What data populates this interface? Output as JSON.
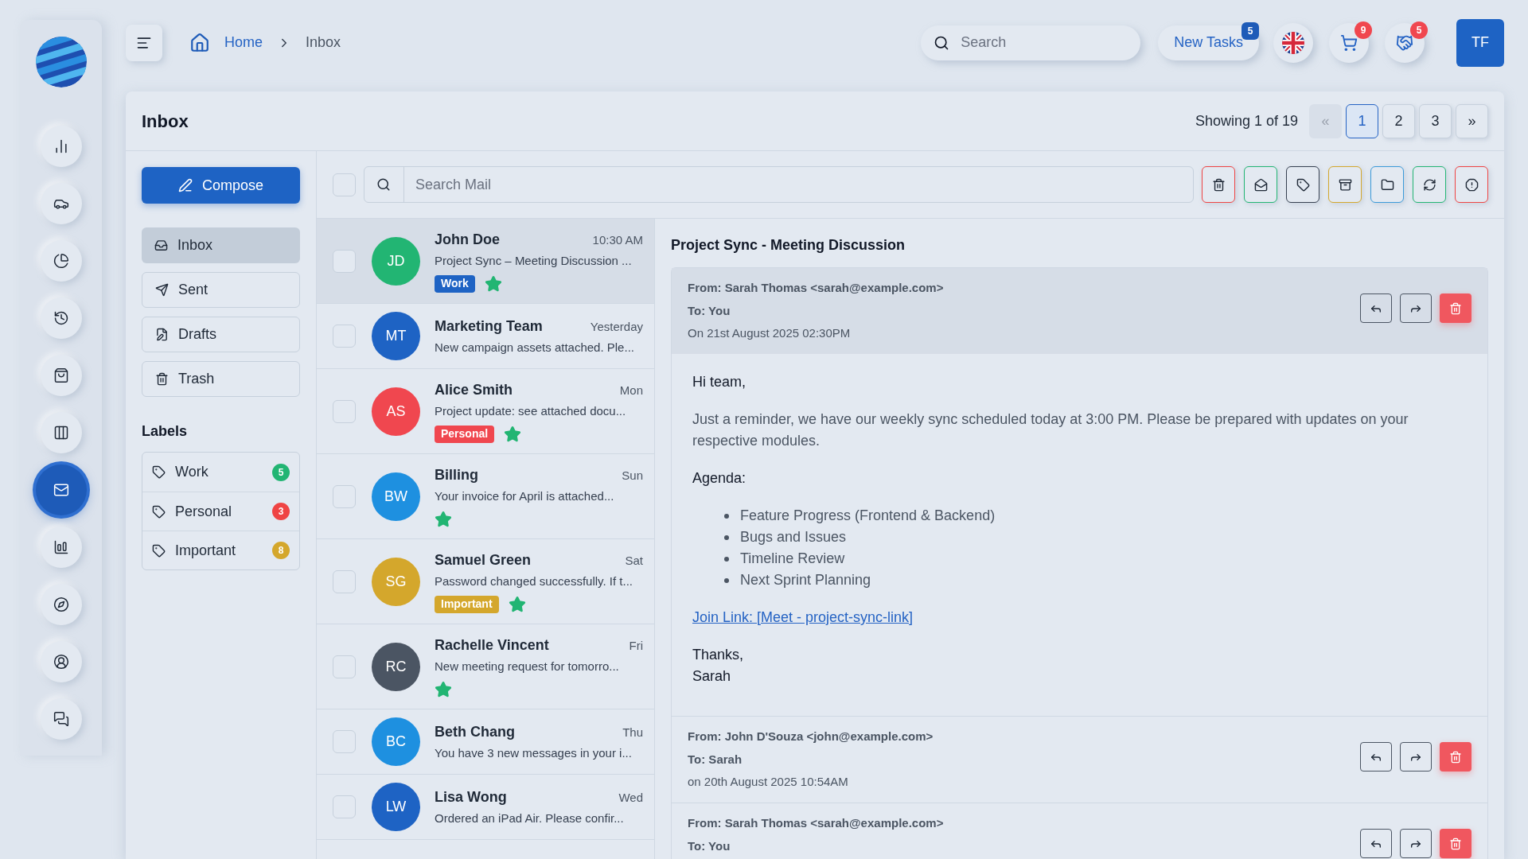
{
  "sidebar": {
    "items": [
      {
        "selected": false
      },
      {
        "selected": false
      },
      {
        "selected": false
      },
      {
        "selected": false
      },
      {
        "selected": false
      },
      {
        "selected": false
      },
      {
        "selected": true
      },
      {
        "selected": false
      },
      {
        "selected": false
      },
      {
        "selected": false
      },
      {
        "selected": false
      }
    ]
  },
  "topbar": {
    "breadcrumb": [
      "Home",
      "Inbox"
    ],
    "search": {
      "placeholder": "Search"
    },
    "new_tasks": {
      "label": "New Tasks",
      "badge": "5"
    },
    "cart_badge": "9",
    "deals_badge": "5",
    "avatar": "TF"
  },
  "inbox": {
    "title": "Inbox",
    "summary": "Showing 1 of 19",
    "pages": [
      {
        "label": "«",
        "selected": false,
        "disabled": true
      },
      {
        "label": "1",
        "selected": true,
        "disabled": false
      },
      {
        "label": "2",
        "selected": false,
        "disabled": false
      },
      {
        "label": "3",
        "selected": false,
        "disabled": false
      },
      {
        "label": "»",
        "selected": false,
        "disabled": false
      }
    ],
    "compose": "Compose",
    "folders": [
      {
        "label": "Inbox",
        "selected": true
      },
      {
        "label": "Sent",
        "selected": false
      },
      {
        "label": "Drafts",
        "selected": false
      },
      {
        "label": "Trash",
        "selected": false
      }
    ],
    "labels_heading": "Labels",
    "labels": [
      {
        "label": "Work",
        "count": "5",
        "color": "#22b573"
      },
      {
        "label": "Personal",
        "count": "3",
        "color": "#ef4444"
      },
      {
        "label": "Important",
        "count": "8",
        "color": "#d4a72c"
      }
    ],
    "search_mail": {
      "placeholder": "Search Mail"
    },
    "select_all": {
      "checked": false
    },
    "actions": [
      {
        "color": "#ef4444"
      },
      {
        "color": "#22b573"
      },
      {
        "color": "#374151"
      },
      {
        "color": "#d4a72c"
      },
      {
        "color": "#3b9ad9"
      },
      {
        "color": "#22b573"
      },
      {
        "color": "#ef4444"
      }
    ],
    "messages": [
      {
        "initials": "JD",
        "color": "#22b573",
        "name": "John Doe",
        "time": "10:30 AM",
        "preview": "Project Sync – Meeting Discussion ...",
        "tag": {
          "label": "Work",
          "color": "#1e63c4"
        },
        "starred": true,
        "selected": true,
        "checked": false
      },
      {
        "initials": "MT",
        "color": "#1e63c4",
        "name": "Marketing Team",
        "time": "Yesterday",
        "preview": "New campaign assets attached. Ple...",
        "starred": false,
        "selected": false,
        "checked": false
      },
      {
        "initials": "AS",
        "color": "#f0474f",
        "name": "Alice Smith",
        "time": "Mon",
        "preview": "Project update: see attached docu...",
        "tag": {
          "label": "Personal",
          "color": "#f0474f"
        },
        "starred": true,
        "selected": false,
        "checked": false
      },
      {
        "initials": "BW",
        "color": "#1e90e0",
        "name": "Billing",
        "time": "Sun",
        "preview": "Your invoice for April is attached...",
        "starred": true,
        "selected": false,
        "checked": false
      },
      {
        "initials": "SG",
        "color": "#d4a72c",
        "name": "Samuel Green",
        "time": "Sat",
        "preview": "Password changed successfully. If t...",
        "tag": {
          "label": "Important",
          "color": "#d4a72c"
        },
        "starred": true,
        "selected": false,
        "checked": false
      },
      {
        "initials": "RC",
        "color": "#4b5563",
        "name": "Rachelle Vincent",
        "time": "Fri",
        "preview": "New meeting request for tomorro...",
        "starred": true,
        "selected": false,
        "checked": false
      },
      {
        "initials": "BC",
        "color": "#1e90e0",
        "name": "Beth Chang",
        "time": "Thu",
        "preview": "You have 3 new messages in your i...",
        "starred": false,
        "selected": false,
        "checked": false
      },
      {
        "initials": "LW",
        "color": "#1e63c4",
        "name": "Lisa Wong",
        "time": "Wed",
        "preview": "Ordered an iPad Air. Please confir...",
        "starred": false,
        "selected": false,
        "checked": false
      }
    ]
  },
  "reader": {
    "subject": "Project Sync - Meeting Discussion",
    "threads": [
      {
        "from": "From: Sarah Thomas <sarah@example.com>",
        "to": "To: You",
        "date": "On 21st August 2025 02:30PM",
        "expanded": true,
        "body": [
          {
            "kind": "paragraph",
            "text": "Hi team,",
            "dark": true
          },
          {
            "kind": "paragraph",
            "text": "Just a reminder, we have our weekly sync scheduled today at 3:00 PM. Please be prepared with updates on your respective modules.",
            "dark": false
          },
          {
            "kind": "paragraph",
            "text": "Agenda:",
            "dark": true
          },
          {
            "kind": "list",
            "items": [
              "Feature Progress (Frontend & Backend)",
              "Bugs and Issues",
              "Timeline Review",
              "Next Sprint Planning"
            ]
          },
          {
            "kind": "link",
            "text": "Join Link: [Meet - project-sync-link]"
          },
          {
            "kind": "lines",
            "items": [
              "Thanks,",
              "Sarah"
            ]
          }
        ]
      },
      {
        "from": "From: John D'Souza <john@example.com>",
        "to": "To: Sarah",
        "date": "on 20th August 2025 10:54AM",
        "expanded": false
      },
      {
        "from": "From: Sarah Thomas <sarah@example.com>",
        "to": "To: You",
        "expanded": false
      }
    ]
  }
}
